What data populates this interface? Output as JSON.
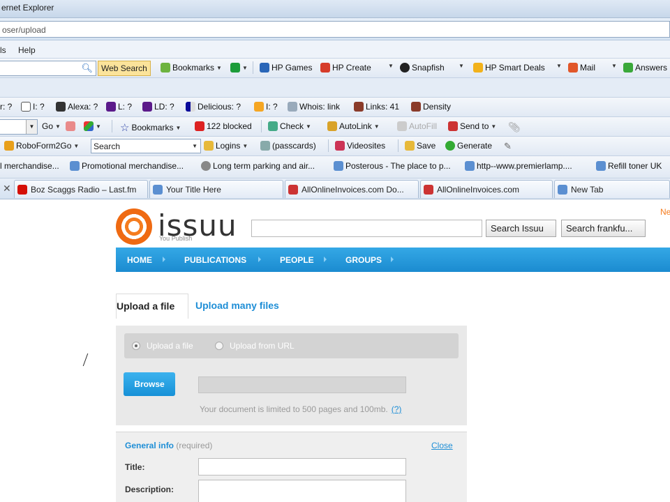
{
  "window": {
    "title": "ernet Explorer"
  },
  "address": {
    "url": "oser/upload"
  },
  "menu": {
    "items": [
      "ls",
      "Help"
    ]
  },
  "toolbar1": {
    "web_search": "Web Search",
    "bookmarks": "Bookmarks",
    "hp_games": "HP Games",
    "hp_create": "HP Create",
    "snapfish": "Snapfish",
    "hp_smart_deals": "HP Smart Deals",
    "mail": "Mail",
    "answers": "Answers"
  },
  "toolbar2": {
    "pr": "r: ?",
    "google": "I: ?",
    "alexa": "Alexa: ?",
    "l": "L: ?",
    "ld": "LD: ?",
    "delicious": "Delicious: ?",
    "i": "I: ?",
    "whois": "Whois: link",
    "links": "Links: 41",
    "density": "Density"
  },
  "toolbar3": {
    "go": "Go",
    "bookmarks": "Bookmarks",
    "blocked": "122 blocked",
    "check": "Check",
    "autolink": "AutoLink",
    "autofill": "AutoFill",
    "send_to": "Send to"
  },
  "toolbar4": {
    "roboform": "RoboForm2Go",
    "search": "Search",
    "logins": "Logins",
    "passcards": "(passcards)",
    "videosites": "Videosites",
    "save": "Save",
    "generate": "Generate"
  },
  "favorites": [
    "l merchandise...",
    "Promotional merchandise...",
    "Long term parking and air...",
    "Posterous - The place to p...",
    "http--www.premierlamp....",
    "Refill toner UK"
  ],
  "tabs": [
    "Boz Scaggs Radio – Last.fm",
    "Your Title Here",
    "AllOnlineInvoices.com Do...",
    "AllOnlineInvoices.com",
    "New Tab"
  ],
  "site": {
    "logo_text": "issuu",
    "tagline": "You Publish",
    "new_link": "Ne",
    "search_button": "Search Issuu",
    "search_button2": "Search frankfu...",
    "nav": [
      "HOME",
      "PUBLICATIONS",
      "PEOPLE",
      "GROUPS"
    ]
  },
  "upload": {
    "tab_active": "Upload a file",
    "tab_other": "Upload many files",
    "radio_file": "Upload a file",
    "radio_url": "Upload from URL",
    "browse": "Browse",
    "limit_text": "Your document is limited to 500 pages and 100mb.",
    "limit_help": "(?)"
  },
  "general": {
    "heading": "General info",
    "required": "(required)",
    "close": "Close",
    "title_label": "Title:",
    "description_label": "Description:"
  },
  "colors": {
    "accent": "#1e8ed6",
    "brand_orange": "#f57c1f"
  }
}
